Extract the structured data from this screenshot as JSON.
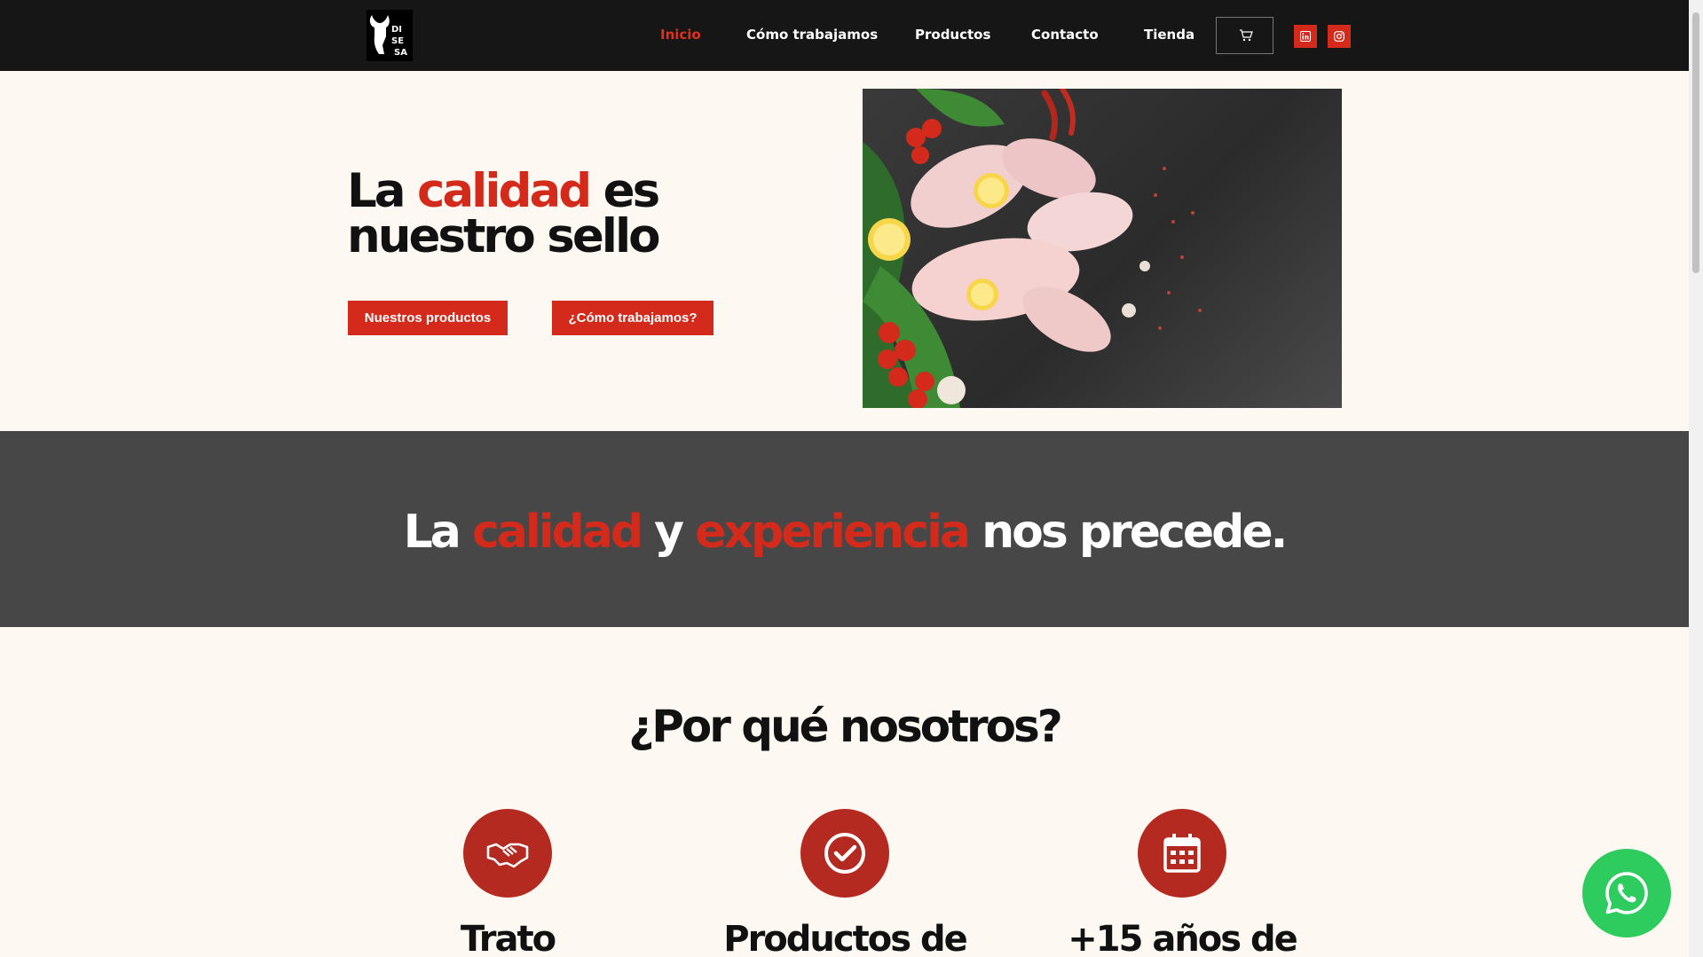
{
  "colors": {
    "accent": "#d42a1c",
    "header_bg": "#161616",
    "band_bg": "#474747",
    "page_bg": "#fdf8f1",
    "whatsapp": "#2ecc5f"
  },
  "logo": {
    "lines": [
      "DI",
      "SE",
      "SA"
    ]
  },
  "nav": {
    "items": [
      {
        "label": "Inicio",
        "active": true
      },
      {
        "label": "Cómo trabajamos"
      },
      {
        "label": "Productos"
      },
      {
        "label": "Contacto"
      },
      {
        "label": "Tienda"
      }
    ],
    "cart_icon": "cart-icon",
    "social": [
      {
        "icon": "linkedin-icon"
      },
      {
        "icon": "instagram-icon"
      }
    ]
  },
  "hero": {
    "title_pre": "La ",
    "title_accent": "calidad",
    "title_post": " es nuestro sello",
    "buttons": [
      "Nuestros productos",
      "¿Cómo trabajamos?"
    ]
  },
  "band": {
    "pre": "La ",
    "accent1": "calidad",
    "mid": " y ",
    "accent2": "experiencia",
    "post": " nos precede."
  },
  "why": {
    "title": "¿Por qué nosotros?",
    "features": [
      {
        "icon": "handshake-icon",
        "title": "Trato"
      },
      {
        "icon": "check-circle-icon",
        "title": "Productos de"
      },
      {
        "icon": "calendar-icon",
        "title": "+15 años de"
      }
    ]
  },
  "whatsapp": {
    "icon": "whatsapp-icon"
  }
}
